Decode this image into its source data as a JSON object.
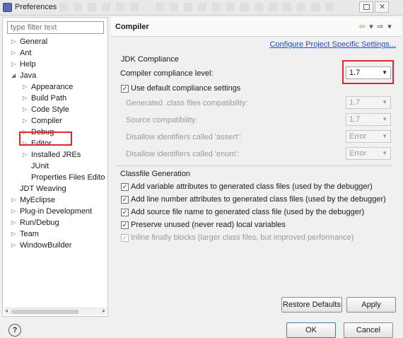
{
  "window": {
    "title": "Preferences"
  },
  "filter": {
    "placeholder": "type filter text"
  },
  "tree": {
    "items": [
      {
        "label": "General",
        "toggle": "▷"
      },
      {
        "label": "Ant",
        "toggle": "▷"
      },
      {
        "label": "Help",
        "toggle": "▷"
      },
      {
        "label": "Java",
        "toggle": "◢"
      },
      {
        "label": "Appearance",
        "toggle": "▷"
      },
      {
        "label": "Build Path",
        "toggle": "▷"
      },
      {
        "label": "Code Style",
        "toggle": "▷"
      },
      {
        "label": "Compiler",
        "toggle": "▷"
      },
      {
        "label": "Debug",
        "toggle": "▷"
      },
      {
        "label": "Editor",
        "toggle": "▷"
      },
      {
        "label": "Installed JREs",
        "toggle": "▷"
      },
      {
        "label": "JUnit",
        "toggle": ""
      },
      {
        "label": "Properties Files Edito",
        "toggle": ""
      },
      {
        "label": "JDT Weaving",
        "toggle": ""
      },
      {
        "label": "MyEclipse",
        "toggle": "▷"
      },
      {
        "label": "Plug-in Development",
        "toggle": "▷"
      },
      {
        "label": "Run/Debug",
        "toggle": "▷"
      },
      {
        "label": "Team",
        "toggle": "▷"
      },
      {
        "label": "WindowBuilder",
        "toggle": "▷"
      }
    ]
  },
  "page": {
    "title": "Compiler",
    "config_link": "Configure Project Specific Settings...",
    "nav": {
      "back": "⇦",
      "menu": "▾",
      "forward": "⇨",
      "more": "▾"
    }
  },
  "jdk": {
    "group_title": "JDK Compliance",
    "compliance_label": "Compiler compliance level:",
    "compliance_value": "1.7",
    "use_default": {
      "label": "Use default compliance settings",
      "checked": true
    },
    "generated_label": "Generated .class files compatibility:",
    "generated_value": "1.7",
    "source_label": "Source compatibility:",
    "source_value": "1.7",
    "assert_label": "Disallow identifiers called 'assert':",
    "assert_value": "Error",
    "enum_label": "Disallow identifiers called 'enum':",
    "enum_value": "Error"
  },
  "classfile": {
    "group_title": "Classfile Generation",
    "options": [
      {
        "label": "Add variable attributes to generated class files (used by the debugger)",
        "checked": true
      },
      {
        "label": "Add line number attributes to generated class files (used by the debugger)",
        "checked": true
      },
      {
        "label": "Add source file name to generated class file (used by the debugger)",
        "checked": true
      },
      {
        "label": "Preserve unused (never read) local variables",
        "checked": true
      },
      {
        "label": "Inline finally blocks (larger class files, but improved performance)",
        "checked": true
      }
    ]
  },
  "buttons": {
    "restore": "Restore Defaults",
    "apply": "Apply",
    "ok": "OK",
    "cancel": "Cancel",
    "help": "?"
  },
  "colors": {
    "highlight": "#e0282e",
    "link": "#1d50c9"
  }
}
